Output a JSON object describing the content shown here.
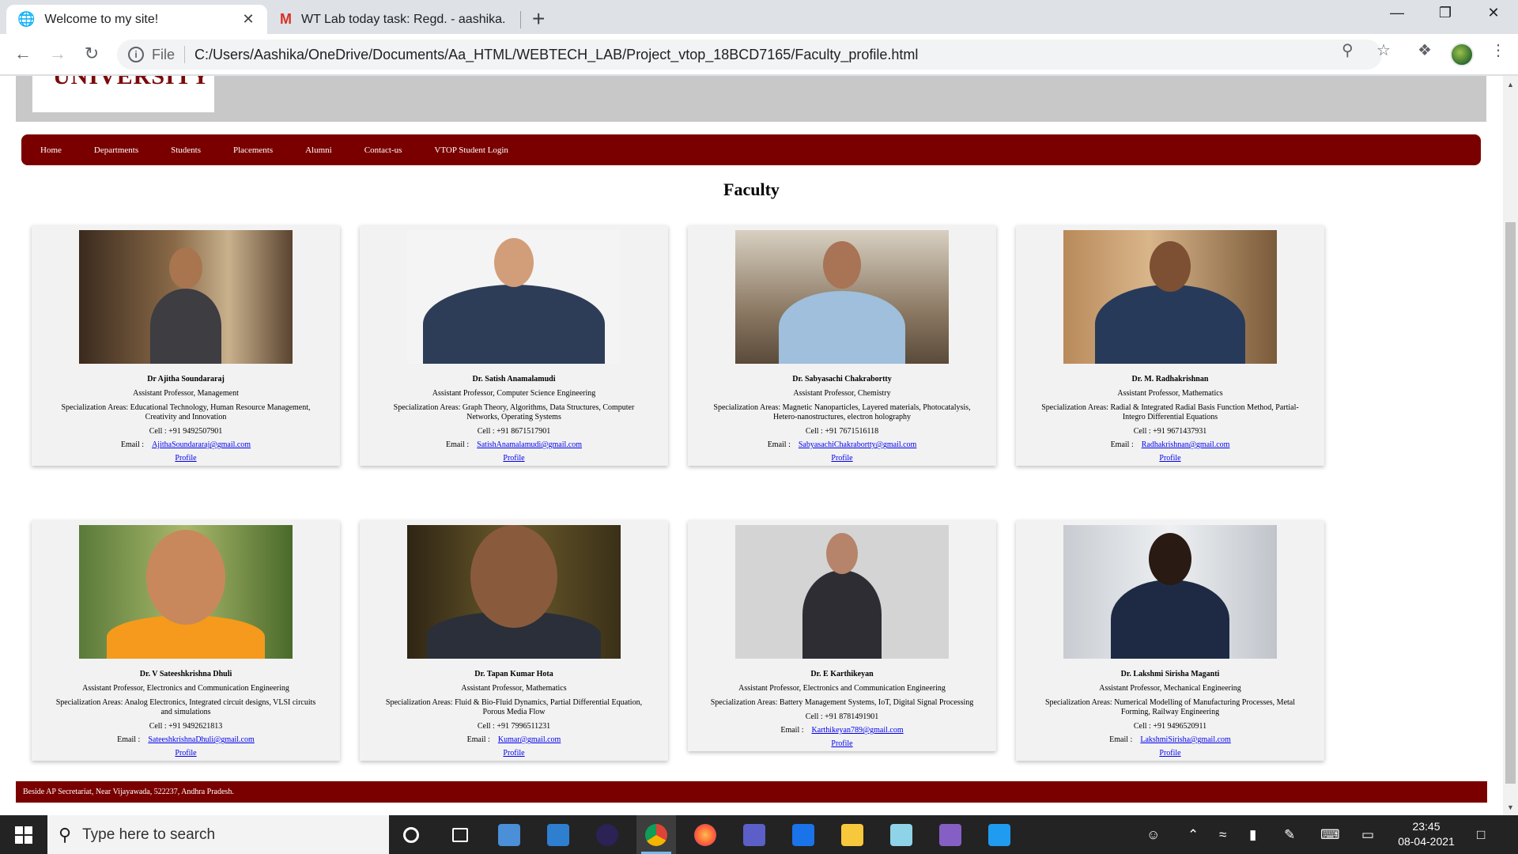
{
  "browser": {
    "tabs": [
      {
        "title": "Welcome to my site!",
        "icon": "globe-icon",
        "active": true
      },
      {
        "title": "WT Lab today task: Regd. - aashika.",
        "icon": "gmail-icon",
        "active": false
      }
    ],
    "address": {
      "scheme": "File",
      "url": "C:/Users/Aashika/OneDrive/Documents/Aa_HTML/WEBTECH_LAB/Project_vtop_18BCD7165/Faculty_profile.html"
    }
  },
  "site": {
    "logo_text": "UNIVERSITY",
    "nav": [
      "Home",
      "Departments",
      "Students",
      "Placements",
      "Alumni",
      "Contact-us",
      "VTOP Student Login"
    ],
    "heading": "Faculty",
    "email_label": "Email :",
    "profile_label": "Profile",
    "faculty": [
      {
        "name": "Dr Ajitha Soundararaj",
        "role": "Assistant Professor, Management",
        "spec": "Specialization Areas: Educational Technology, Human Resource Management, Creativity and Innovation",
        "cell": "Cell : +91 9492507901",
        "email": "AjithaSoundararaj@gmail.com"
      },
      {
        "name": "Dr. Satish Anamalamudi",
        "role": "Assistant Professor, Computer Science Engineering",
        "spec": "Specialization Areas: Graph Theory, Algorithms, Data Structures, Computer Networks, Operating Systems",
        "cell": "Cell : +91 8671517901",
        "email": "SatishAnamalamudi@gmail.com"
      },
      {
        "name": "Dr. Sabyasachi Chakrabortty",
        "role": "Assistant Professor, Chemistry",
        "spec": "Specialization Areas: Magnetic Nanoparticles, Layered materials, Photocatalysis, Hetero-nanostructures, electron holography",
        "cell": "Cell : +91 7671516118",
        "email": "SabyasachiChakrabortty@gmail.com"
      },
      {
        "name": "Dr. M. Radhakrishnan",
        "role": "Assistant Professor, Mathematics",
        "spec": "Specialization Areas: Radial & Integrated Radial Basis Function Method, Partial-Integro Differential Equations",
        "cell": "Cell : +91 9671437931",
        "email": "Radhakrishnan@gmail.com"
      },
      {
        "name": "Dr. V Sateeshkrishna Dhuli",
        "role": "Assistant Professor, Electronics and Communication Engineering",
        "spec": "Specialization Areas: Analog Electronics, Integrated circuit designs, VLSI circuits and simulations",
        "cell": "Cell : +91 9492621813",
        "email": "SateeshkrishnaDhuli@gmail.com"
      },
      {
        "name": "Dr. Tapan Kumar Hota",
        "role": "Assistant Professor, Mathematics",
        "spec": "Specialization Areas: Fluid & Bio-Fluid Dynamics, Partial Differential Equation, Porous Media Flow",
        "cell": "Cell : +91 7996511231",
        "email": "Kumar@gmail.com"
      },
      {
        "name": "Dr. E Karthikeyan",
        "role": "Assistant Professor, Electronics and Communication Engineering",
        "spec": "Specialization Areas: Battery Management Systems, IoT, Digital Signal Processing",
        "cell": "Cell : +91 8781491901",
        "email": "Karthikeyan789@gmail.com"
      },
      {
        "name": "Dr. Lakshmi Sirisha Maganti",
        "role": "Assistant Professor, Mechanical Engineering",
        "spec": "Specialization Areas: Numerical Modelling of Manufacturing Processes, Metal Forming, Railway Engineering",
        "cell": "Cell : +91 9496520911",
        "email": "LakshmiSirisha@gmail.com"
      }
    ],
    "footer": "Beside AP Secretariat, Near Vijayawada, 522237, Andhra Pradesh."
  },
  "taskbar": {
    "search_placeholder": "Type here to search",
    "time": "23:45",
    "date": "08-04-2021"
  },
  "colors": {
    "brand": "#7a0000",
    "header_gray": "#c8c8c8",
    "card_bg": "#f2f2f2",
    "link": "#0000ee"
  }
}
